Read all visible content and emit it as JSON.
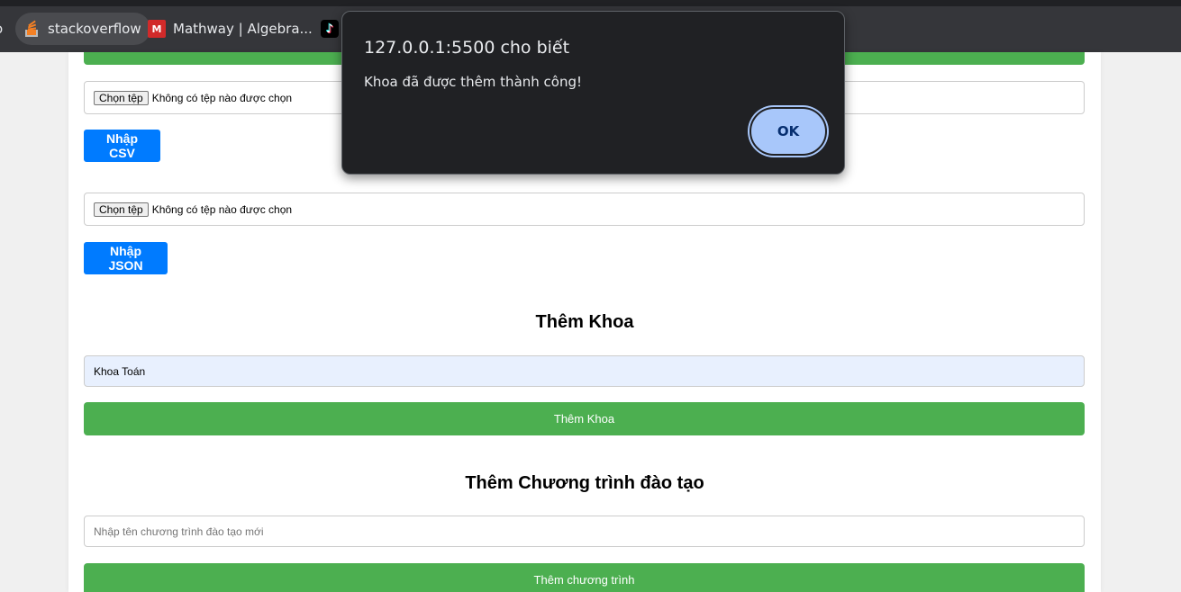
{
  "bookmarks_bar": {
    "edge_label": "o",
    "items": [
      {
        "label": "stackoverflow",
        "icon": "stackoverflow-icon"
      },
      {
        "label": "Mathway | Algebra...",
        "icon": "mathway-icon"
      },
      {
        "label": "",
        "icon": "tiktok-icon"
      }
    ],
    "mathway_icon_text": "M",
    "tiktok_icon_text": "♪"
  },
  "import_csv": {
    "file_button": "Chọn tệp",
    "file_status": "Không có tệp nào được chọn",
    "submit_label": "Nhập CSV"
  },
  "import_json": {
    "file_button": "Chọn tệp",
    "file_status": "Không có tệp nào được chọn",
    "submit_label": "Nhập JSON"
  },
  "add_department": {
    "heading": "Thêm Khoa",
    "input_value": "Khoa Toán",
    "submit_label": "Thêm Khoa"
  },
  "add_program": {
    "heading": "Thêm Chương trình đào tạo",
    "input_placeholder": "Nhập tên chương trình đào tạo mới",
    "submit_label": "Thêm chương trình"
  },
  "alert": {
    "title": "127.0.0.1:5500 cho biết",
    "message": "Khoa đã được thêm thành công!",
    "ok_label": "OK"
  },
  "colors": {
    "primary_blue": "#007bff",
    "success_green": "#4caf50",
    "dialog_bg": "#202124",
    "dialog_button": "#a8c7fa"
  }
}
